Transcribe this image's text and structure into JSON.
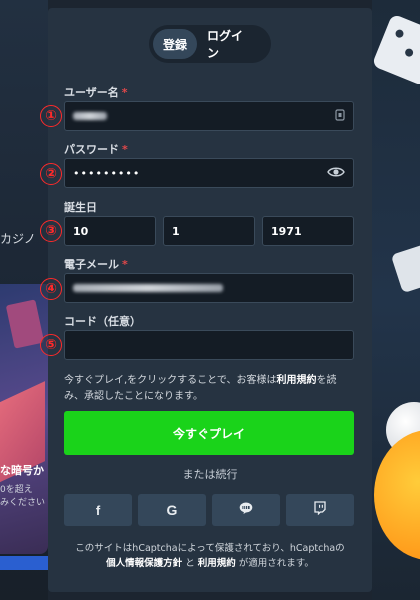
{
  "background": {
    "left_text": "カジノ",
    "promo_title": "な暗号か",
    "promo_sub_1": "0を超え",
    "promo_sub_2": "みください"
  },
  "tabs": [
    {
      "label": "登録",
      "active": true
    },
    {
      "label": "ログイン",
      "active": false
    }
  ],
  "fields": {
    "username": {
      "label": "ユーザー名",
      "required_mark": "*",
      "value": ""
    },
    "password": {
      "label": "パスワード",
      "required_mark": "*",
      "value": "•••••••••"
    },
    "birthdate": {
      "label": "誕生日",
      "day": "10",
      "month": "1",
      "year": "1971"
    },
    "email": {
      "label": "電子メール",
      "required_mark": "*",
      "value": ""
    },
    "code": {
      "label": "コード（任意）",
      "value": ""
    }
  },
  "markers": [
    "①",
    "②",
    "③",
    "④",
    "⑤"
  ],
  "terms": {
    "part1": "今すぐプレイ,をクリックすることで、お客様は",
    "link": "利用規約",
    "part2": "を読み、承認したことになります。"
  },
  "play_button": "今すぐプレイ",
  "or_continue": "または続行",
  "social": [
    {
      "name": "facebook",
      "icon": "facebook-icon",
      "glyph": "f"
    },
    {
      "name": "google",
      "icon": "google-icon",
      "glyph": "G"
    },
    {
      "name": "line",
      "icon": "line-icon",
      "glyph": ""
    },
    {
      "name": "twitch",
      "icon": "twitch-icon",
      "glyph": ""
    }
  ],
  "captcha": {
    "part1": "このサイトはhCaptchaによって保護されており、hCaptchaの",
    "privacy": "個人情報保護方針",
    "and": " と ",
    "terms": "利用規約",
    "part2": " が適用されます。"
  },
  "colors": {
    "modal_bg": "#263341",
    "input_bg": "#141c25",
    "play_green": "#1ad31a",
    "required_red": "#e0484a",
    "marker_red": "#ff2a2a"
  }
}
